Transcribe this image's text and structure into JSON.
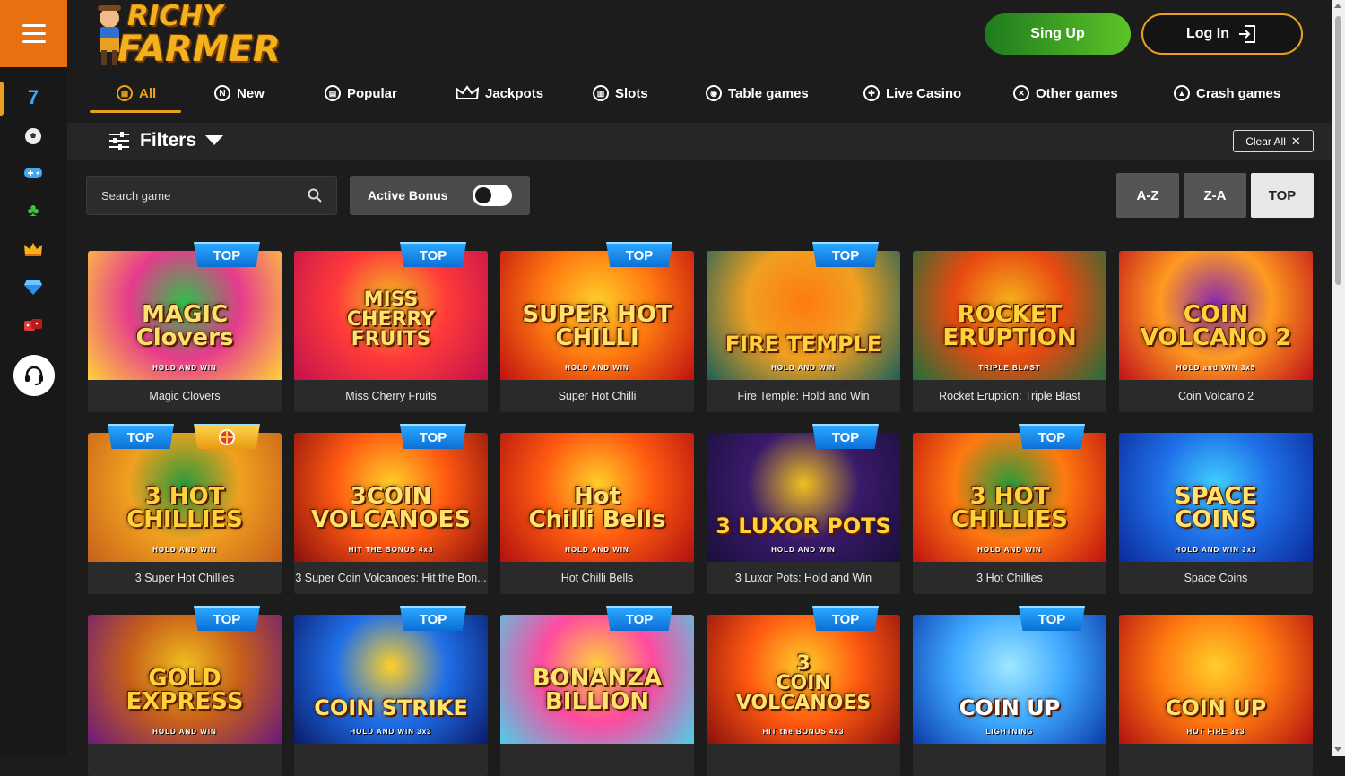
{
  "header": {
    "logo_top": "RICHY",
    "logo_bottom": "FARMER",
    "signup_label": "Sing Up",
    "login_label": "Log In"
  },
  "sidebar": {
    "icons": [
      "seven-icon",
      "soccer-ball-icon",
      "gamepad-icon",
      "clover-icon",
      "crown-icon",
      "diamond-icon",
      "dice-icon"
    ],
    "support_icon": "headset-icon"
  },
  "tabs": [
    {
      "label": "All",
      "active": true
    },
    {
      "label": "New",
      "active": false
    },
    {
      "label": "Popular",
      "active": false
    },
    {
      "label": "Jackpots",
      "active": false
    },
    {
      "label": "Slots",
      "active": false
    },
    {
      "label": "Table games",
      "active": false
    },
    {
      "label": "Live Casino",
      "active": false
    },
    {
      "label": "Other games",
      "active": false
    },
    {
      "label": "Crash games",
      "active": false
    }
  ],
  "filters": {
    "label": "Filters",
    "clear_label": "Clear All"
  },
  "search": {
    "placeholder": "Search game"
  },
  "bonus": {
    "label": "Active Bonus",
    "on": false
  },
  "sort": [
    {
      "label": "A-Z",
      "active": false
    },
    {
      "label": "Z-A",
      "active": false
    },
    {
      "label": "TOP",
      "active": true
    }
  ],
  "games": [
    {
      "name": "Magic Clovers",
      "thumb_title": "MAGIC\nClovers",
      "thumb_sub": "HOLD AND WIN",
      "badge": "TOP"
    },
    {
      "name": "Miss Cherry Fruits",
      "thumb_title": "MISS\nCHERRY\nFRUITS",
      "thumb_sub": "",
      "badge": "TOP"
    },
    {
      "name": "Super Hot Chilli",
      "thumb_title": "SUPER HOT\nCHILLI",
      "thumb_sub": "HOLD AND WIN",
      "badge": "TOP"
    },
    {
      "name": "Fire Temple: Hold and Win",
      "thumb_title": "FIRE TEMPLE",
      "thumb_sub": "HOLD AND WIN",
      "badge": "TOP"
    },
    {
      "name": "Rocket Eruption: Triple Blast",
      "thumb_title": "ROCKET\nERUPTION",
      "thumb_sub": "TRIPLE BLAST",
      "badge": ""
    },
    {
      "name": "Coin Volcano 2",
      "thumb_title": "COIN\nVOLCANO 2",
      "thumb_sub": "HOLD and WIN 3x5",
      "badge": ""
    },
    {
      "name": "3 Super Hot Chillies",
      "thumb_title": "3 HOT\nCHILLIES",
      "thumb_sub": "HOLD AND WIN",
      "badge": "TOP"
    },
    {
      "name": "3 Super Coin Volcanoes: Hit the Bon...",
      "thumb_title": "3COIN\nVOLCANOES",
      "thumb_sub": "HIT THE BONUS 4x3",
      "badge": "TOP"
    },
    {
      "name": "Hot Chilli Bells",
      "thumb_title": "Hot\nChilli Bells",
      "thumb_sub": "HOLD AND WIN",
      "badge": ""
    },
    {
      "name": "3 Luxor Pots: Hold and Win",
      "thumb_title": "3 LUXOR POTS",
      "thumb_sub": "HOLD AND WIN",
      "badge": "TOP"
    },
    {
      "name": "3 Hot Chillies",
      "thumb_title": "3 HOT\nCHILLIES",
      "thumb_sub": "HOLD AND WIN",
      "badge": "TOP"
    },
    {
      "name": "Space Coins",
      "thumb_title": "SPACE\nCOINS",
      "thumb_sub": "HOLD AND WIN 3x3",
      "badge": ""
    },
    {
      "name": "",
      "thumb_title": "GOLD\nEXPRESS",
      "thumb_sub": "HOLD AND WIN",
      "badge": "TOP"
    },
    {
      "name": "",
      "thumb_title": "COIN STRIKE",
      "thumb_sub": "HOLD AND WIN 3x3",
      "badge": "TOP"
    },
    {
      "name": "",
      "thumb_title": "BONANZA\nBILLION",
      "thumb_sub": "",
      "badge": "TOP"
    },
    {
      "name": "",
      "thumb_title": "3\nCOIN\nVOLCANOES",
      "thumb_sub": "HIT the BONUS 4x3",
      "badge": "TOP"
    },
    {
      "name": "",
      "thumb_title": "COIN UP",
      "thumb_sub": "LIGHTNING",
      "badge": "TOP"
    },
    {
      "name": "",
      "thumb_title": "COIN UP",
      "thumb_sub": "HOT FIRE 3x3",
      "badge": ""
    }
  ]
}
